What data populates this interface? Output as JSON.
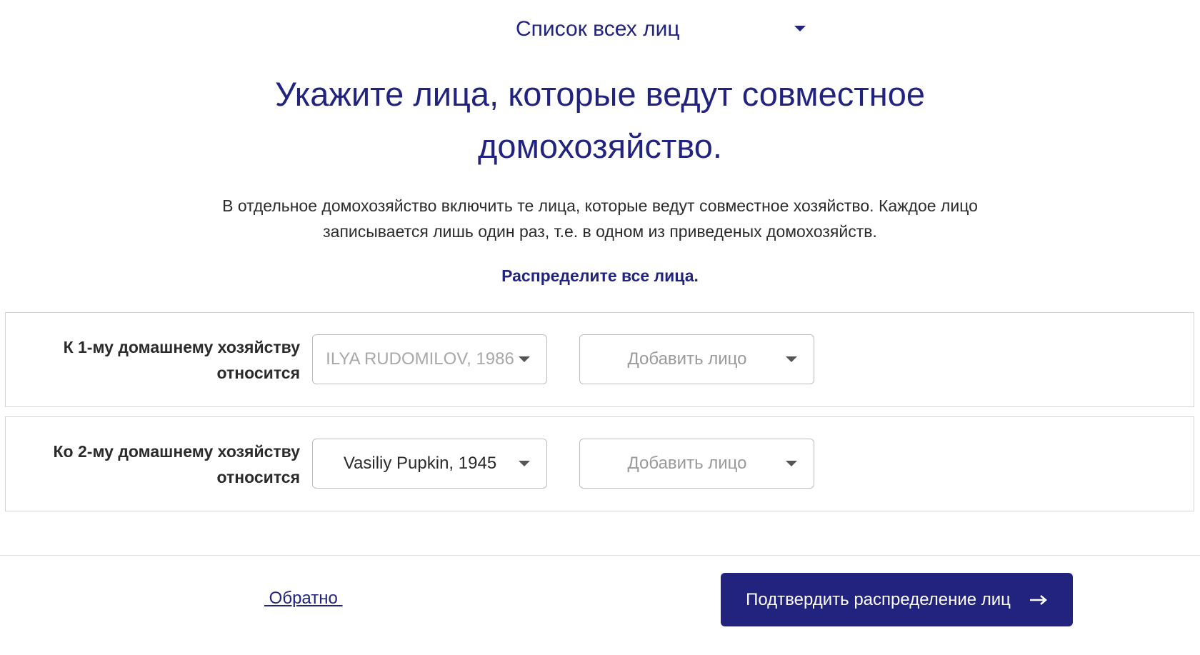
{
  "persons_list": {
    "label": "Список всех лиц"
  },
  "title": "Укажите лица, которые ведут совместное домохозяйство.",
  "description": "В отдельное домохозяйство включить те лица, которые ведут совместное хозяйство. Каждое лицо записывается лишь один раз, т.е. в одном из приведеных домохозяйств.",
  "instruction": "Распределите все лица.",
  "households": [
    {
      "label_line1": "К 1-му домашнему хозяйству",
      "label_line2": "относится",
      "person_value": "ILYA RUDOMILOV, 1986",
      "add_placeholder": "Добавить лицо"
    },
    {
      "label_line1": "Ко 2-му домашнему хозяйству",
      "label_line2": "относится",
      "person_value": "Vasiliy Pupkin, 1945",
      "add_placeholder": "Добавить лицо"
    }
  ],
  "footer": {
    "back_label": " Обратно ",
    "confirm_label": "Подтвердить распределение лиц"
  },
  "icons": {
    "dropdown": "chevron-down-icon",
    "confirm": "arrow-right-icon"
  },
  "colors": {
    "primary": "#22237f",
    "text": "#2b2b2b",
    "disabled_text": "#a8a8a8",
    "border": "#bdbdbd"
  }
}
